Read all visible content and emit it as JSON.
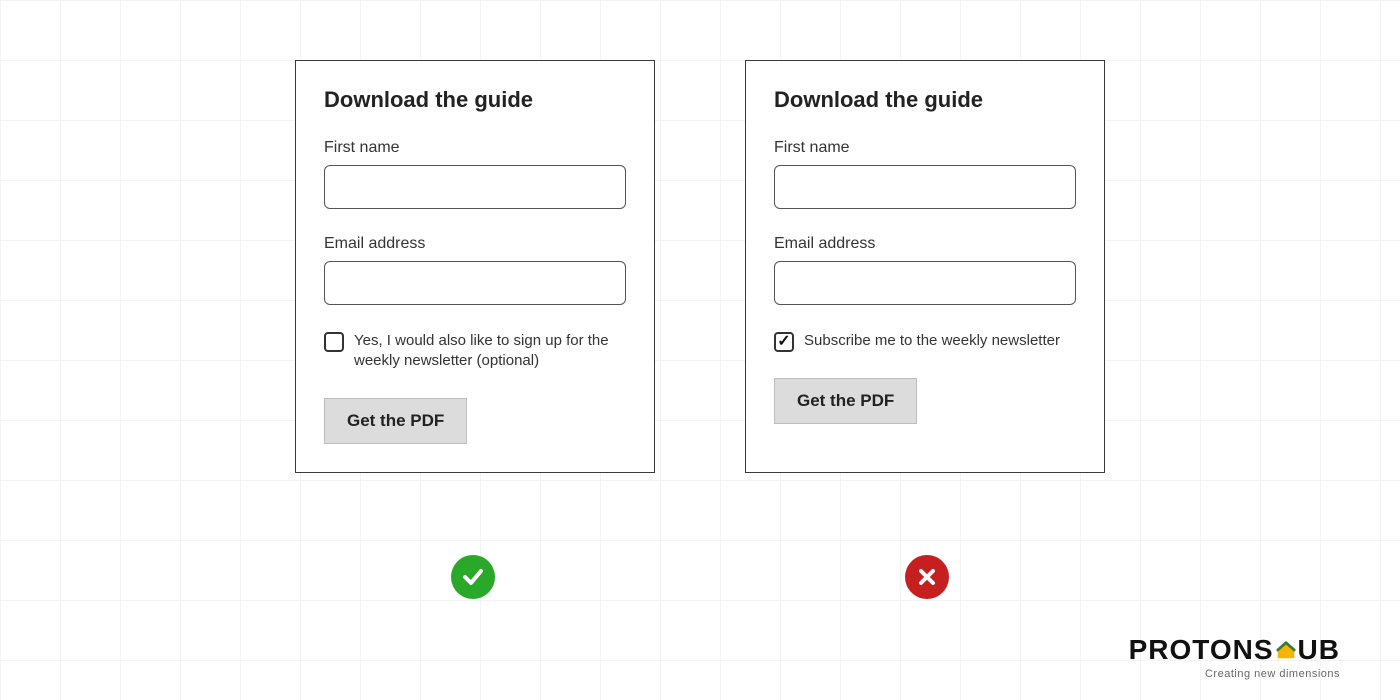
{
  "good_form": {
    "title": "Download the guide",
    "first_name_label": "First name",
    "first_name_value": "",
    "email_label": "Email address",
    "email_value": "",
    "checkbox_checked": false,
    "checkbox_label": "Yes, I would also like to sign up for the weekly newsletter (optional)",
    "submit_label": "Get the PDF",
    "verdict": "good"
  },
  "bad_form": {
    "title": "Download the guide",
    "first_name_label": "First name",
    "first_name_value": "",
    "email_label": "Email address",
    "email_value": "",
    "checkbox_checked": true,
    "checkbox_label": "Subscribe me to the weekly newsletter",
    "submit_label": "Get the PDF",
    "verdict": "bad"
  },
  "brand": {
    "name_left": "PROTONS",
    "name_right": "UB",
    "tagline": "Creating new dimensions"
  },
  "colors": {
    "good": "#2aa82a",
    "bad": "#c61f1f",
    "brand_accent": "#f4b400"
  }
}
